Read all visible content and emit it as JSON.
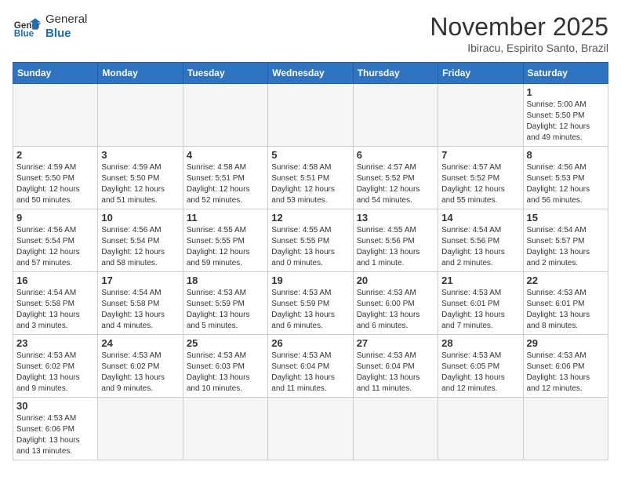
{
  "logo": {
    "text_general": "General",
    "text_blue": "Blue"
  },
  "title": "November 2025",
  "subtitle": "Ibiracu, Espirito Santo, Brazil",
  "days_of_week": [
    "Sunday",
    "Monday",
    "Tuesday",
    "Wednesday",
    "Thursday",
    "Friday",
    "Saturday"
  ],
  "weeks": [
    [
      {
        "day": "",
        "info": ""
      },
      {
        "day": "",
        "info": ""
      },
      {
        "day": "",
        "info": ""
      },
      {
        "day": "",
        "info": ""
      },
      {
        "day": "",
        "info": ""
      },
      {
        "day": "",
        "info": ""
      },
      {
        "day": "1",
        "info": "Sunrise: 5:00 AM\nSunset: 5:50 PM\nDaylight: 12 hours\nand 49 minutes."
      }
    ],
    [
      {
        "day": "2",
        "info": "Sunrise: 4:59 AM\nSunset: 5:50 PM\nDaylight: 12 hours\nand 50 minutes."
      },
      {
        "day": "3",
        "info": "Sunrise: 4:59 AM\nSunset: 5:50 PM\nDaylight: 12 hours\nand 51 minutes."
      },
      {
        "day": "4",
        "info": "Sunrise: 4:58 AM\nSunset: 5:51 PM\nDaylight: 12 hours\nand 52 minutes."
      },
      {
        "day": "5",
        "info": "Sunrise: 4:58 AM\nSunset: 5:51 PM\nDaylight: 12 hours\nand 53 minutes."
      },
      {
        "day": "6",
        "info": "Sunrise: 4:57 AM\nSunset: 5:52 PM\nDaylight: 12 hours\nand 54 minutes."
      },
      {
        "day": "7",
        "info": "Sunrise: 4:57 AM\nSunset: 5:52 PM\nDaylight: 12 hours\nand 55 minutes."
      },
      {
        "day": "8",
        "info": "Sunrise: 4:56 AM\nSunset: 5:53 PM\nDaylight: 12 hours\nand 56 minutes."
      }
    ],
    [
      {
        "day": "9",
        "info": "Sunrise: 4:56 AM\nSunset: 5:54 PM\nDaylight: 12 hours\nand 57 minutes."
      },
      {
        "day": "10",
        "info": "Sunrise: 4:56 AM\nSunset: 5:54 PM\nDaylight: 12 hours\nand 58 minutes."
      },
      {
        "day": "11",
        "info": "Sunrise: 4:55 AM\nSunset: 5:55 PM\nDaylight: 12 hours\nand 59 minutes."
      },
      {
        "day": "12",
        "info": "Sunrise: 4:55 AM\nSunset: 5:55 PM\nDaylight: 13 hours\nand 0 minutes."
      },
      {
        "day": "13",
        "info": "Sunrise: 4:55 AM\nSunset: 5:56 PM\nDaylight: 13 hours\nand 1 minute."
      },
      {
        "day": "14",
        "info": "Sunrise: 4:54 AM\nSunset: 5:56 PM\nDaylight: 13 hours\nand 2 minutes."
      },
      {
        "day": "15",
        "info": "Sunrise: 4:54 AM\nSunset: 5:57 PM\nDaylight: 13 hours\nand 2 minutes."
      }
    ],
    [
      {
        "day": "16",
        "info": "Sunrise: 4:54 AM\nSunset: 5:58 PM\nDaylight: 13 hours\nand 3 minutes."
      },
      {
        "day": "17",
        "info": "Sunrise: 4:54 AM\nSunset: 5:58 PM\nDaylight: 13 hours\nand 4 minutes."
      },
      {
        "day": "18",
        "info": "Sunrise: 4:53 AM\nSunset: 5:59 PM\nDaylight: 13 hours\nand 5 minutes."
      },
      {
        "day": "19",
        "info": "Sunrise: 4:53 AM\nSunset: 5:59 PM\nDaylight: 13 hours\nand 6 minutes."
      },
      {
        "day": "20",
        "info": "Sunrise: 4:53 AM\nSunset: 6:00 PM\nDaylight: 13 hours\nand 6 minutes."
      },
      {
        "day": "21",
        "info": "Sunrise: 4:53 AM\nSunset: 6:01 PM\nDaylight: 13 hours\nand 7 minutes."
      },
      {
        "day": "22",
        "info": "Sunrise: 4:53 AM\nSunset: 6:01 PM\nDaylight: 13 hours\nand 8 minutes."
      }
    ],
    [
      {
        "day": "23",
        "info": "Sunrise: 4:53 AM\nSunset: 6:02 PM\nDaylight: 13 hours\nand 9 minutes."
      },
      {
        "day": "24",
        "info": "Sunrise: 4:53 AM\nSunset: 6:02 PM\nDaylight: 13 hours\nand 9 minutes."
      },
      {
        "day": "25",
        "info": "Sunrise: 4:53 AM\nSunset: 6:03 PM\nDaylight: 13 hours\nand 10 minutes."
      },
      {
        "day": "26",
        "info": "Sunrise: 4:53 AM\nSunset: 6:04 PM\nDaylight: 13 hours\nand 11 minutes."
      },
      {
        "day": "27",
        "info": "Sunrise: 4:53 AM\nSunset: 6:04 PM\nDaylight: 13 hours\nand 11 minutes."
      },
      {
        "day": "28",
        "info": "Sunrise: 4:53 AM\nSunset: 6:05 PM\nDaylight: 13 hours\nand 12 minutes."
      },
      {
        "day": "29",
        "info": "Sunrise: 4:53 AM\nSunset: 6:06 PM\nDaylight: 13 hours\nand 12 minutes."
      }
    ],
    [
      {
        "day": "30",
        "info": "Sunrise: 4:53 AM\nSunset: 6:06 PM\nDaylight: 13 hours\nand 13 minutes."
      },
      {
        "day": "",
        "info": ""
      },
      {
        "day": "",
        "info": ""
      },
      {
        "day": "",
        "info": ""
      },
      {
        "day": "",
        "info": ""
      },
      {
        "day": "",
        "info": ""
      },
      {
        "day": "",
        "info": ""
      }
    ]
  ]
}
